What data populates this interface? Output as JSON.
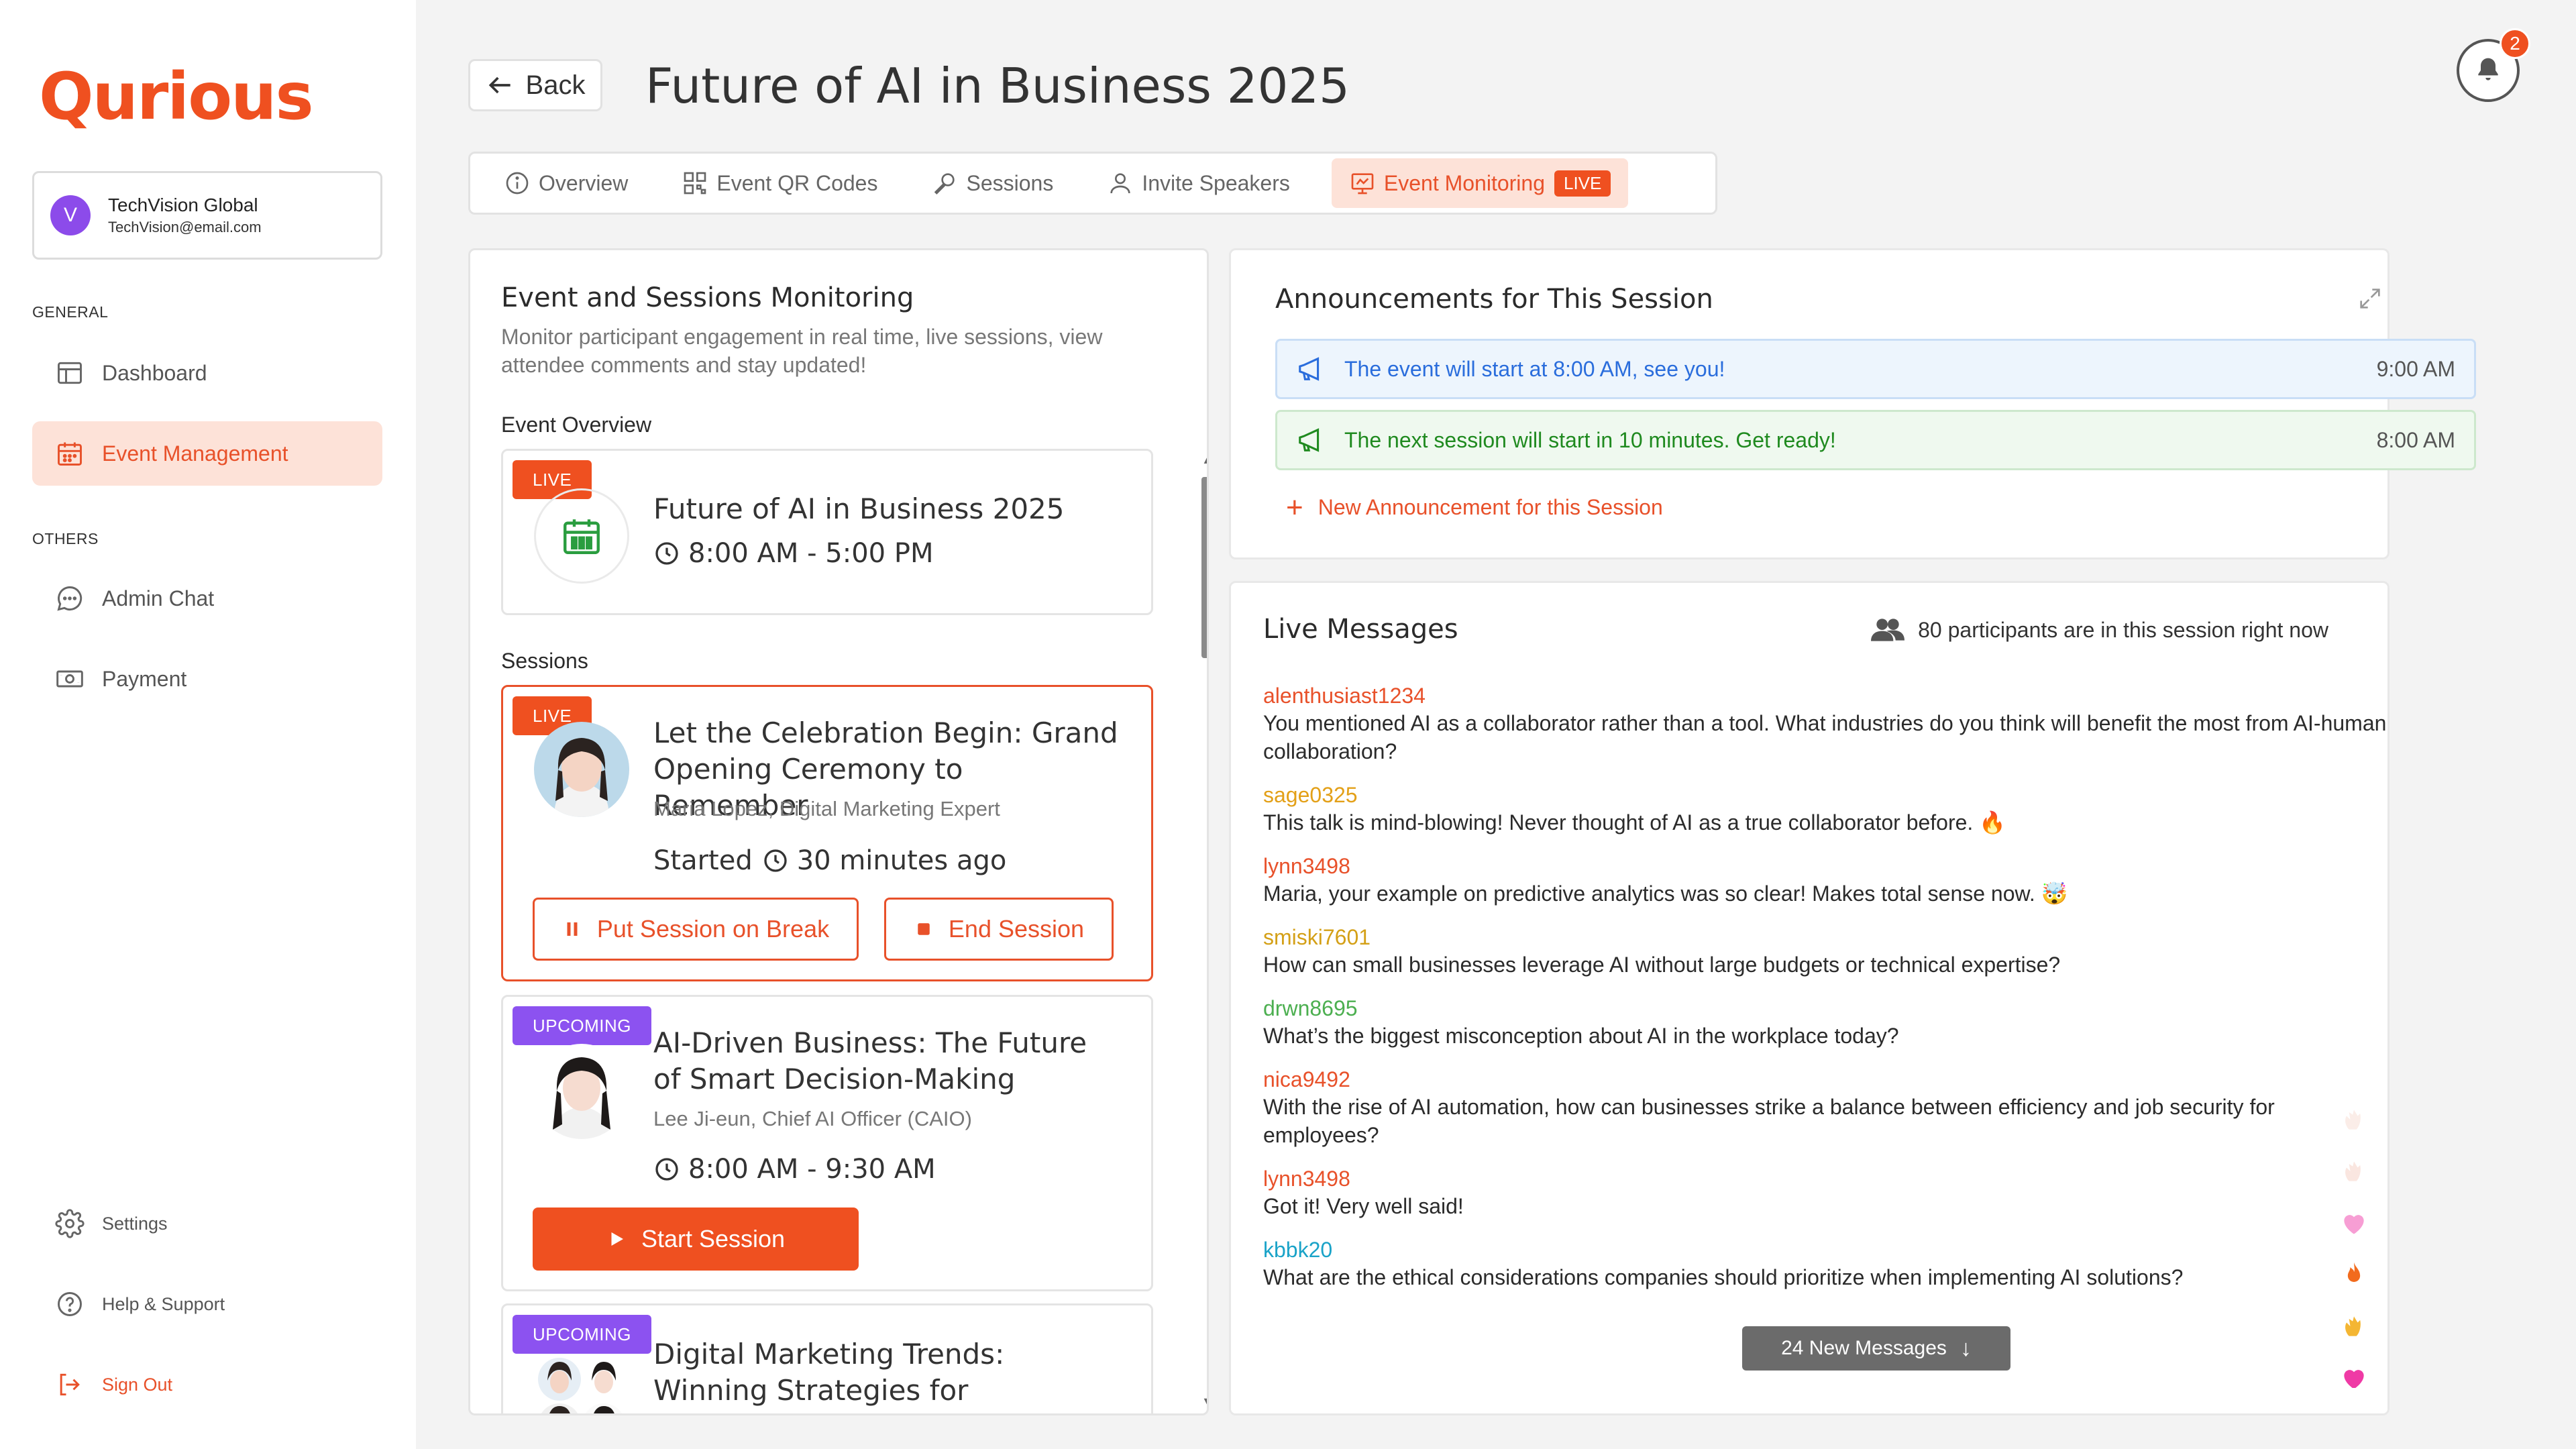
{
  "brand": {
    "logo_text": "Qurious",
    "accent": "#ef5020"
  },
  "org": {
    "initial": "V",
    "name": "TechVision Global",
    "email": "TechVision@email.com"
  },
  "sidebar": {
    "general_label": "GENERAL",
    "others_label": "OTHERS",
    "items": [
      {
        "label": "Dashboard",
        "icon": "dashboard-icon"
      },
      {
        "label": "Event Management",
        "icon": "calendar-icon",
        "active": true
      },
      {
        "label": "Admin Chat",
        "icon": "chat-icon"
      },
      {
        "label": "Payment",
        "icon": "payment-icon"
      }
    ],
    "bottom": [
      {
        "label": "Settings",
        "icon": "gear-icon"
      },
      {
        "label": "Help & Support",
        "icon": "help-icon"
      },
      {
        "label": "Sign Out",
        "icon": "signout-icon"
      }
    ]
  },
  "header": {
    "back_label": "Back",
    "title": "Future of AI in Business 2025",
    "notification_count": "2"
  },
  "tabs": [
    {
      "label": "Overview",
      "icon": "info-icon"
    },
    {
      "label": "Event QR Codes",
      "icon": "qr-icon"
    },
    {
      "label": "Sessions",
      "icon": "mic-icon"
    },
    {
      "label": "Invite Speakers",
      "icon": "user-icon"
    },
    {
      "label": "Event Monitoring",
      "icon": "monitor-icon",
      "active": true,
      "badge": "LIVE"
    }
  ],
  "monitoring": {
    "title": "Event and Sessions Monitoring",
    "description": "Monitor participant engagement in real time, live sessions, view attendee comments and stay updated!",
    "overview_label": "Event Overview",
    "sessions_label": "Sessions",
    "event": {
      "badge": "LIVE",
      "title": "Future of AI in Business 2025",
      "time": "8:00 AM - 5:00 PM"
    },
    "sessions": [
      {
        "badge": "LIVE",
        "title": "Let the Celebration Begin: Grand Opening Ceremony to Remember",
        "speaker": "Maria Lopez, Digital Marketing Expert",
        "started_prefix": "Started",
        "started": "30 minutes ago",
        "break_label": "Put Session on Break",
        "end_label": "End Session"
      },
      {
        "badge": "UPCOMING",
        "title": "AI-Driven Business: The Future of Smart Decision-Making",
        "speaker": "Lee Ji-eun, Chief AI Officer (CAIO)",
        "time": "8:00 AM - 9:30 AM",
        "start_label": "Start Session"
      },
      {
        "badge": "UPCOMING",
        "title": "Digital Marketing Trends: Winning Strategies for Engagement"
      }
    ]
  },
  "announcements": {
    "title": "Announcements for This Session",
    "items": [
      {
        "text": "The event will start at 8:00 AM, see you!",
        "time": "9:00 AM",
        "color": "#2a6ddc"
      },
      {
        "text": "The next session will start in 10 minutes. Get ready!",
        "time": "8:00 AM",
        "color": "#1f8a1f"
      }
    ],
    "new_label": "New Announcement for this Session"
  },
  "live_messages": {
    "title": "Live Messages",
    "participants": "80 participants are in this session right now",
    "new_messages": "24 New Messages",
    "messages": [
      {
        "user": "alenthusiast1234",
        "color": "#e8512a",
        "text": "You mentioned AI as a collaborator rather than a tool. What industries do you think will benefit the most from AI-human collaboration?"
      },
      {
        "user": "sage0325",
        "color": "#e3a018",
        "text": "This talk is mind-blowing! Never thought of AI as a true collaborator before. 🔥"
      },
      {
        "user": "lynn3498",
        "color": "#e8512a",
        "text": "Maria, your example on predictive analytics was so clear! Makes total sense now. 🤯"
      },
      {
        "user": "smiski7601",
        "color": "#d4a017",
        "text": "How can small businesses leverage AI without large budgets or technical expertise?"
      },
      {
        "user": "drwn8695",
        "color": "#4caf50",
        "text": "What’s the biggest misconception about AI in the workplace today?"
      },
      {
        "user": "nica9492",
        "color": "#e8512a",
        "text": "With the rise of AI automation, how can businesses strike a balance between efficiency and job security for employees?"
      },
      {
        "user": "lynn3498",
        "color": "#e8512a",
        "text": "Got it! Very well said!"
      },
      {
        "user": "kbbk20",
        "color": "#1aa3c8",
        "text": "What are the ethical considerations companies should prioritize when implementing AI solutions?"
      }
    ]
  }
}
